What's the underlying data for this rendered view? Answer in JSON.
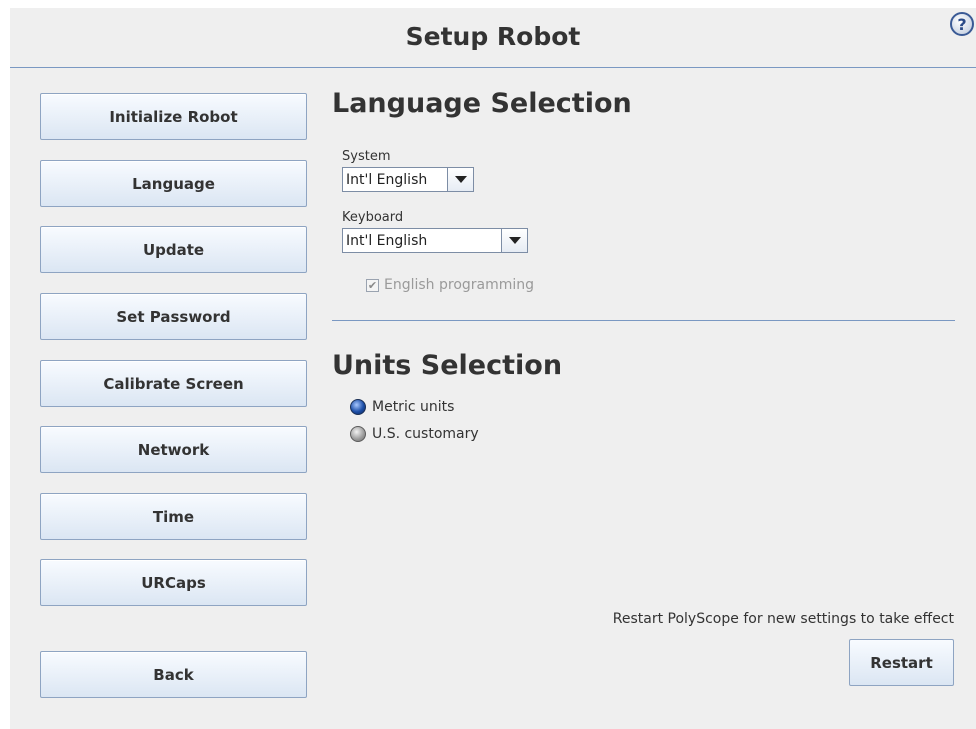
{
  "header": {
    "title": "Setup Robot",
    "help_glyph": "?"
  },
  "sidebar": {
    "items": [
      {
        "label": "Initialize Robot"
      },
      {
        "label": "Language"
      },
      {
        "label": "Update"
      },
      {
        "label": "Set Password"
      },
      {
        "label": "Calibrate Screen"
      },
      {
        "label": "Network"
      },
      {
        "label": "Time"
      },
      {
        "label": "URCaps"
      }
    ],
    "back_label": "Back"
  },
  "language": {
    "title": "Language Selection",
    "system_label": "System",
    "system_value": "Int'l English",
    "keyboard_label": "Keyboard",
    "keyboard_value": "Int'l English",
    "english_programming_label": "English programming",
    "english_programming_checked": true,
    "english_programming_enabled": false
  },
  "units": {
    "title": "Units Selection",
    "options": [
      {
        "label": "Metric units",
        "selected": true
      },
      {
        "label": "U.S. customary",
        "selected": false
      }
    ]
  },
  "footer": {
    "restart_message": "Restart PolyScope for new settings to take effect",
    "restart_label": "Restart"
  },
  "icons": {
    "help": "help-icon",
    "dropdown": "chevron-down-icon",
    "check": "checkmark-icon"
  },
  "colors": {
    "background": "#efefef",
    "divider": "#7a98c2",
    "button_top": "#f8fbff",
    "button_bottom": "#dbe6f3",
    "radio_selected": "#1d4fa8",
    "disabled_text": "#9a9a9a"
  }
}
